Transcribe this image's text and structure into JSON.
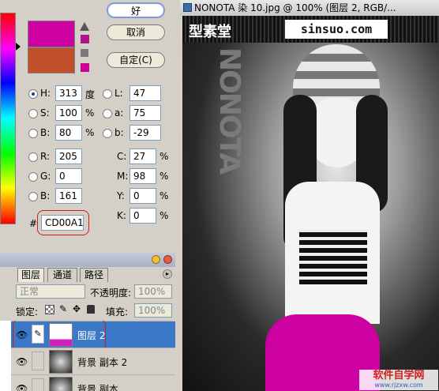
{
  "color_picker": {
    "ok_label": "好",
    "cancel_label": "取消",
    "custom_label": "自定(C)",
    "new_color": "#CD00A1",
    "old_color": "#C0502A",
    "fields": {
      "H": {
        "label": "H:",
        "value": "313",
        "unit": "度"
      },
      "S": {
        "label": "S:",
        "value": "100",
        "unit": "%"
      },
      "Bv": {
        "label": "B:",
        "value": "80",
        "unit": "%"
      },
      "R": {
        "label": "R:",
        "value": "205"
      },
      "G": {
        "label": "G:",
        "value": "0"
      },
      "Bc": {
        "label": "B:",
        "value": "161"
      },
      "L": {
        "label": "L:",
        "value": "47"
      },
      "a": {
        "label": "a:",
        "value": "75"
      },
      "b": {
        "label": "b:",
        "value": "-29"
      },
      "C": {
        "label": "C:",
        "value": "27",
        "unit": "%"
      },
      "M": {
        "label": "M:",
        "value": "98",
        "unit": "%"
      },
      "Y": {
        "label": "Y:",
        "value": "0",
        "unit": "%"
      },
      "K": {
        "label": "K:",
        "value": "0",
        "unit": "%"
      }
    },
    "hex_label": "#",
    "hex_value": "CD00A1"
  },
  "layers_panel": {
    "tabs": [
      "图层",
      "通道",
      "路径"
    ],
    "blend_mode": "正常",
    "opacity_label": "不透明度:",
    "opacity_value": "100%",
    "lock_label": "锁定:",
    "fill_label": "填充:",
    "fill_value": "100%",
    "layers": [
      {
        "name": "图层 2"
      },
      {
        "name": "背景 副本 2"
      },
      {
        "name": "背景 副本"
      }
    ]
  },
  "image_window": {
    "title": "NONOTA 染 10.jpg @ 100% (图层 2, RGB/...",
    "header_left": "型素堂",
    "header_right": "sinsuo.com",
    "vertical_text": "NONOTA",
    "watermark": "软件自学网",
    "watermark_url": "www.rjzxw.com"
  }
}
